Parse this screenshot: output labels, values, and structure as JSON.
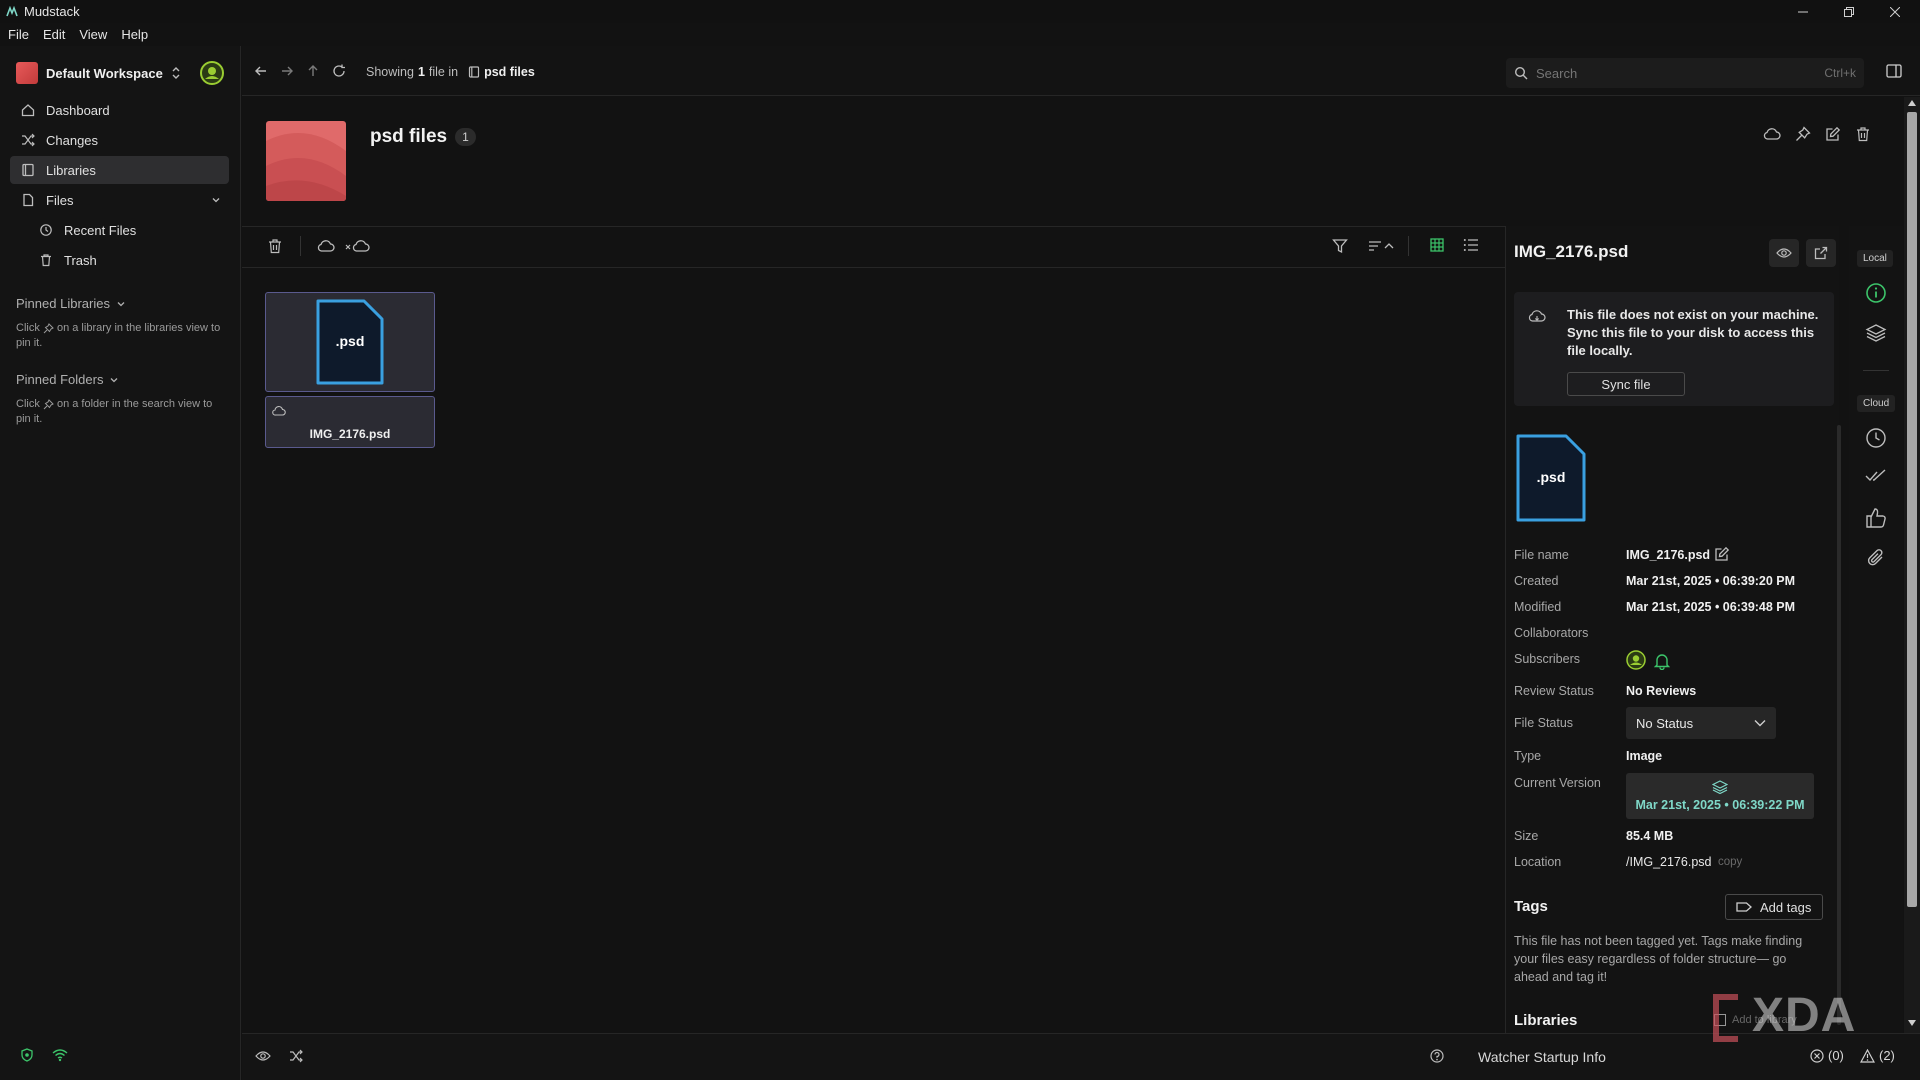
{
  "app": {
    "title": "Mudstack"
  },
  "menu": [
    "File",
    "Edit",
    "View",
    "Help"
  ],
  "workspace": {
    "name": "Default Workspace"
  },
  "nav": {
    "dashboard": "Dashboard",
    "changes": "Changes",
    "libraries": "Libraries",
    "files": "Files",
    "recent_files": "Recent Files",
    "trash": "Trash"
  },
  "pinned_libraries": {
    "title": "Pinned Libraries",
    "hint_a": "Click",
    "hint_b": "on a library in the libraries view to pin it."
  },
  "pinned_folders": {
    "title": "Pinned Folders",
    "hint_a": "Click",
    "hint_b": "on a folder in the search view to pin it."
  },
  "breadcrumb": {
    "prefix": "Showing",
    "count": "1",
    "suffix": "file in",
    "location": "psd files"
  },
  "search": {
    "placeholder": "Search",
    "shortcut": "Ctrl+k"
  },
  "library": {
    "title": "psd files",
    "count": "1",
    "thumb_color": "#e06a6a"
  },
  "file_card": {
    "ext": ".psd",
    "name": "IMG_2176.psd"
  },
  "details": {
    "title": "IMG_2176.psd",
    "sync_message": "This file does not exist on your machine. Sync this file to your disk to access this file locally.",
    "sync_button": "Sync file",
    "ext": ".psd",
    "labels": {
      "file_name": "File name",
      "created": "Created",
      "modified": "Modified",
      "collaborators": "Collaborators",
      "subscribers": "Subscribers",
      "review_status": "Review Status",
      "file_status": "File Status",
      "type": "Type",
      "current_version": "Current Version",
      "size": "Size",
      "location": "Location"
    },
    "values": {
      "file_name": "IMG_2176.psd",
      "created": "Mar 21st, 2025 • 06:39:20 PM",
      "modified": "Mar 21st, 2025 • 06:39:48 PM",
      "review_status": "No Reviews",
      "file_status": "No Status",
      "type": "Image",
      "current_version": "Mar 21st, 2025 • 06:39:22 PM",
      "size": "85.4 MB",
      "location": "/IMG_2176.psd",
      "copy": "copy"
    },
    "tags_title": "Tags",
    "add_tags": "Add tags",
    "tags_message": "This file has not been tagged yet. Tags make finding your files easy regardless of folder structure— go ahead and tag it!",
    "libraries_title": "Libraries",
    "add_to_library": "Add to library"
  },
  "rail": {
    "local": "Local",
    "cloud": "Cloud"
  },
  "status": {
    "watcher": "Watcher Startup Info",
    "errors": "(0)",
    "warnings": "(2)"
  },
  "watermark": "XDA",
  "colors": {
    "accent": "#3aa0e0",
    "file_icon_bg": "#0e1a2b",
    "version_text": "#7fd8c8",
    "online": "#3cc46a"
  }
}
